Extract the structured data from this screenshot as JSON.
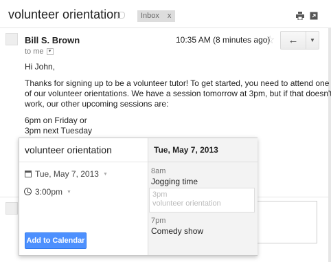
{
  "header": {
    "subject": "volunteer orientation",
    "label": "Inbox",
    "label_remove": "x"
  },
  "message": {
    "sender": "Bill S. Brown",
    "recipient": "to me",
    "time": "10:35 AM (8 minutes ago)",
    "reply_icon": "←",
    "more_icon": "▼",
    "body": [
      "Hi John,",
      "Thanks for signing up to be a volunteer tutor! To get started, you need to attend one",
      "of our volunteer orientations. We have a session tomorrow at 3pm, but if that doesn't",
      "work, our other upcoming sessions are:",
      "6pm on Friday or",
      "3pm next Tuesday"
    ]
  },
  "popup": {
    "title": "volunteer orientation",
    "date": "Tue, May 7, 2013",
    "time": "3:00pm",
    "add_button": "Add to Calendar",
    "day_header": "Tue, May 7, 2013",
    "events": [
      {
        "time": "8am",
        "title": "Jogging time"
      },
      {
        "time": "3pm",
        "title": "volunteer orientation"
      },
      {
        "time": "7pm",
        "title": "Comedy show"
      }
    ]
  },
  "icons": {
    "star": "☆",
    "dropdown": "▼"
  },
  "colors": {
    "primary_button": "#4d90fe",
    "label_bg": "#dddddd"
  }
}
